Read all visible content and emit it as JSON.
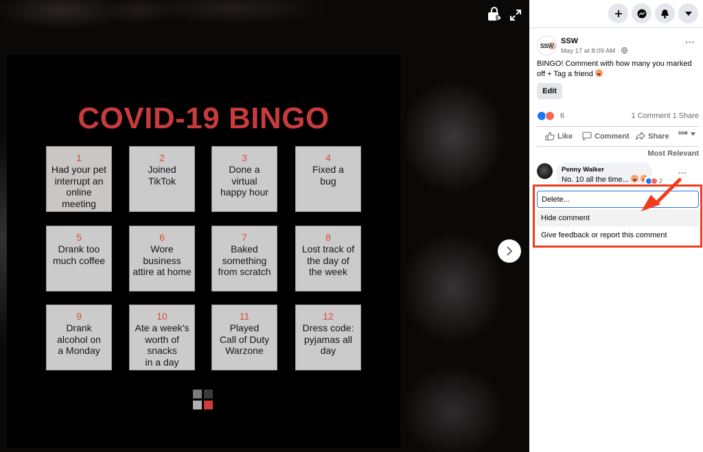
{
  "viewer": {
    "tag_icon": "shopping-bag-tag-icon",
    "fullscreen_icon": "expand-icon",
    "next_icon": "chevron-right-icon",
    "photo": {
      "title": "COVID-19 BINGO",
      "cells": [
        {
          "num": "1",
          "text": "Had your pet interrupt an online meeting"
        },
        {
          "num": "2",
          "text": "Joined TikTok"
        },
        {
          "num": "3",
          "text": "Done a virtual happy hour"
        },
        {
          "num": "4",
          "text": "Fixed a bug"
        },
        {
          "num": "5",
          "text": "Drank too much coffee"
        },
        {
          "num": "6",
          "text": "Wore business attire at home"
        },
        {
          "num": "7",
          "text": "Baked something from scratch"
        },
        {
          "num": "8",
          "text": "Lost track of the day of the week"
        },
        {
          "num": "9",
          "text": "Drank alcohol on a Monday"
        },
        {
          "num": "10",
          "text": "Ate a week's worth of snacks in a day"
        },
        {
          "num": "11",
          "text": "Played Call of Duty Warzone"
        },
        {
          "num": "12",
          "text": "Dress code: pyjamas all day"
        }
      ],
      "logo_colors": [
        "#7a7a7a",
        "#3a3a3a",
        "#b0b0b0",
        "#d03c3c"
      ]
    }
  },
  "topbar": {
    "buttons": [
      {
        "name": "create-button",
        "icon": "plus-icon"
      },
      {
        "name": "messenger-button",
        "icon": "messenger-icon"
      },
      {
        "name": "notifications-button",
        "icon": "bell-icon"
      },
      {
        "name": "account-button",
        "icon": "caret-down-icon"
      }
    ]
  },
  "post": {
    "avatar_text": "SSW",
    "page_name": "SSW",
    "meta": "May 17 at 8:09 AM ·",
    "privacy_icon": "globe-icon",
    "text": "BINGO! Comment with how many you marked off + Tag a friend",
    "edit_label": "Edit",
    "reaction_count": "6",
    "comments_count": "1 Comment",
    "shares_count": "1 Share",
    "actions": {
      "like": "Like",
      "comment": "Comment",
      "share": "Share"
    },
    "sort_label": "Most Relevant"
  },
  "comment": {
    "author": "Penny Walker",
    "text": "No. 10 all the time...",
    "reaction_count": "2"
  },
  "menu": {
    "items": [
      {
        "label": "Delete..."
      },
      {
        "label": "Hide comment"
      },
      {
        "label": "Give feedback or report this comment"
      }
    ]
  },
  "colors": {
    "accent_red": "#c73b3c",
    "annotation_red": "#f23a1c",
    "focus_blue": "#1b74e4"
  }
}
